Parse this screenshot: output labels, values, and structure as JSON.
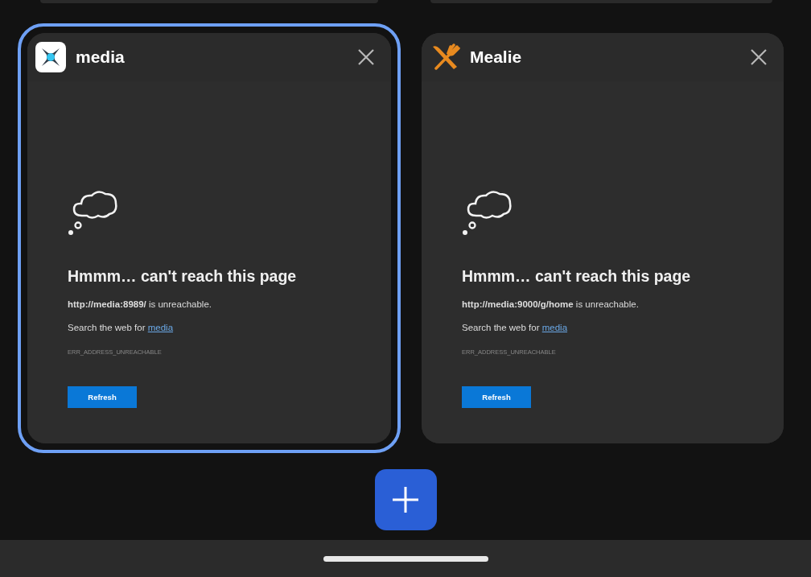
{
  "tabs": [
    {
      "title": "media",
      "selected": true,
      "error": {
        "heading": "Hmmm… can't reach this page",
        "message": "**http://media:8989/** is unreachable.",
        "search_prefix": "Search the web for",
        "search_link": "media",
        "code": "ERR_ADDRESS_UNREACHABLE",
        "button": "Refresh"
      }
    },
    {
      "title": "Mealie",
      "selected": false,
      "error": {
        "heading": "Hmmm… can't reach this page",
        "message": "**http://media:9000/g/home** is unreachable.",
        "search_prefix": "Search the web for",
        "search_link": "media",
        "code": "ERR_ADDRESS_UNREACHABLE",
        "button": "Refresh"
      }
    }
  ]
}
